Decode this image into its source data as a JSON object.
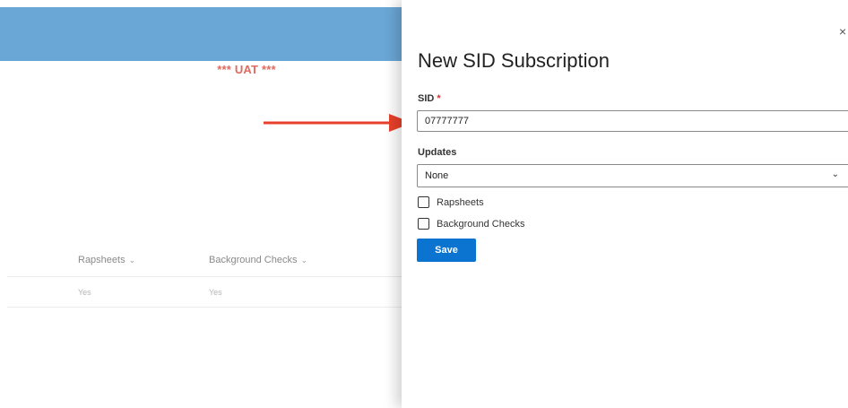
{
  "background": {
    "environment_banner": "*** UAT ***",
    "table": {
      "columns": [
        {
          "label": "Rapsheets"
        },
        {
          "label": "Background Checks"
        }
      ],
      "rows": [
        {
          "rapsheets": "Yes",
          "background_checks": "Yes"
        }
      ]
    }
  },
  "panel": {
    "title": "New SID Subscription",
    "close_icon": "×",
    "sid": {
      "label": "SID",
      "required_marker": "*",
      "value": "07777777"
    },
    "updates": {
      "label": "Updates",
      "selected": "None"
    },
    "checkboxes": [
      {
        "label": "Rapsheets",
        "checked": false
      },
      {
        "label": "Background Checks",
        "checked": false
      }
    ],
    "save_label": "Save"
  },
  "icons": {
    "column_sort": "chevron-down-icon",
    "select_chevron": "chevron-down-icon",
    "annotation": "arrow-right-icon"
  },
  "colors": {
    "header_bar": "#6aa6d6",
    "uat_text": "#e06a5e",
    "arrow": "#e8402a",
    "primary_button": "#0a74d0",
    "required": "#d13438"
  }
}
